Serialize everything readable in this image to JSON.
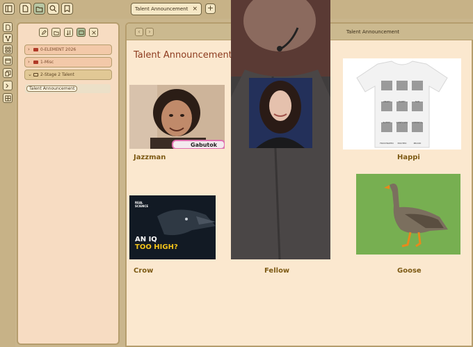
{
  "tab": {
    "title": "Talent Announcement",
    "close": "×",
    "new": "+"
  },
  "sidebar": {
    "folders": [
      {
        "label": "0-ELEMENT 2026",
        "chevron": "›"
      },
      {
        "label": "1-Misc",
        "chevron": "›"
      },
      {
        "label": "2-Stage 2 Talent",
        "chevron": "⌄"
      }
    ],
    "note": "Talent Announcement"
  },
  "view": {
    "header_title": "Talent Announcement",
    "back": "‹",
    "forward": "›",
    "note_title": "Talent Announcement",
    "captions": [
      "Jazzman",
      "Happi",
      "Crow",
      "Fellow",
      "Goose"
    ],
    "crow_thumb": {
      "brand_top": "REAL",
      "brand_bottom": "SCIENCE",
      "headline_1": "AN IQ",
      "headline_2": "TOO HIGH?"
    },
    "jazz_thumb_text": "Gabutok",
    "shirt_labels": [
      "ANGRY",
      "HAPPY",
      "SAD",
      "SLEEPY",
      "CONFUSED",
      "CHEERFUL",
      "FRUSTRATED",
      "EXCITED",
      "PROUD"
    ]
  },
  "colors": {
    "accent_title": "#8c3a1e",
    "caption": "#7d5a14",
    "panel": "#fbe8cf",
    "chrome": "#c7b287"
  }
}
